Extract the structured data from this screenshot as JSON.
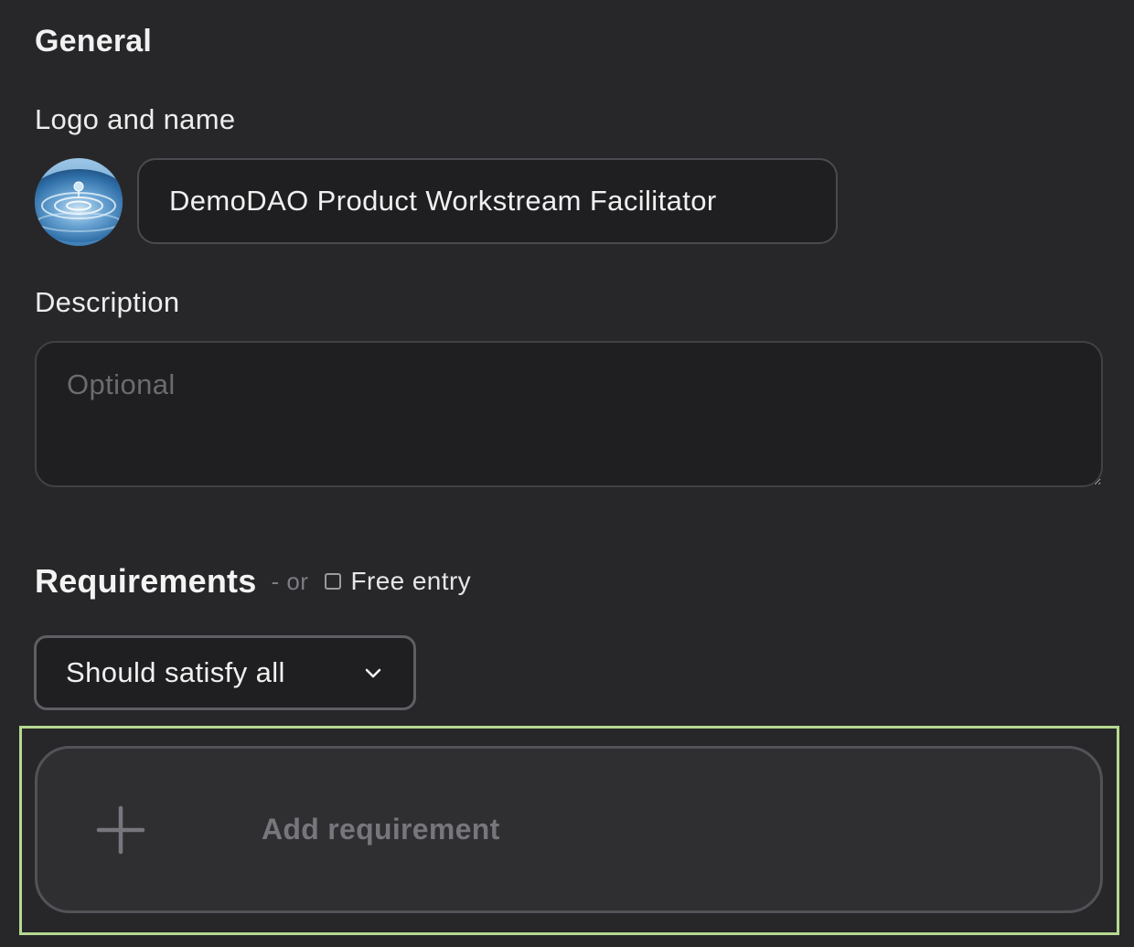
{
  "general": {
    "title": "General"
  },
  "logo_and_name": {
    "label": "Logo and name",
    "name_value": "DemoDAO Product Workstream Facilitator"
  },
  "description": {
    "label": "Description",
    "placeholder": "Optional",
    "value": ""
  },
  "requirements": {
    "title": "Requirements",
    "or_text": "- or",
    "free_entry_label": "Free entry",
    "free_entry_checked": false,
    "logic_select_value": "Should satisfy all",
    "add_label": "Add requirement"
  },
  "icons": {
    "logo": "water-droplet-logo",
    "chevron": "chevron-down-icon",
    "plus": "plus-icon"
  },
  "colors": {
    "background": "#27272a",
    "input_background": "#1f1f21",
    "highlight": "#b6d990"
  }
}
